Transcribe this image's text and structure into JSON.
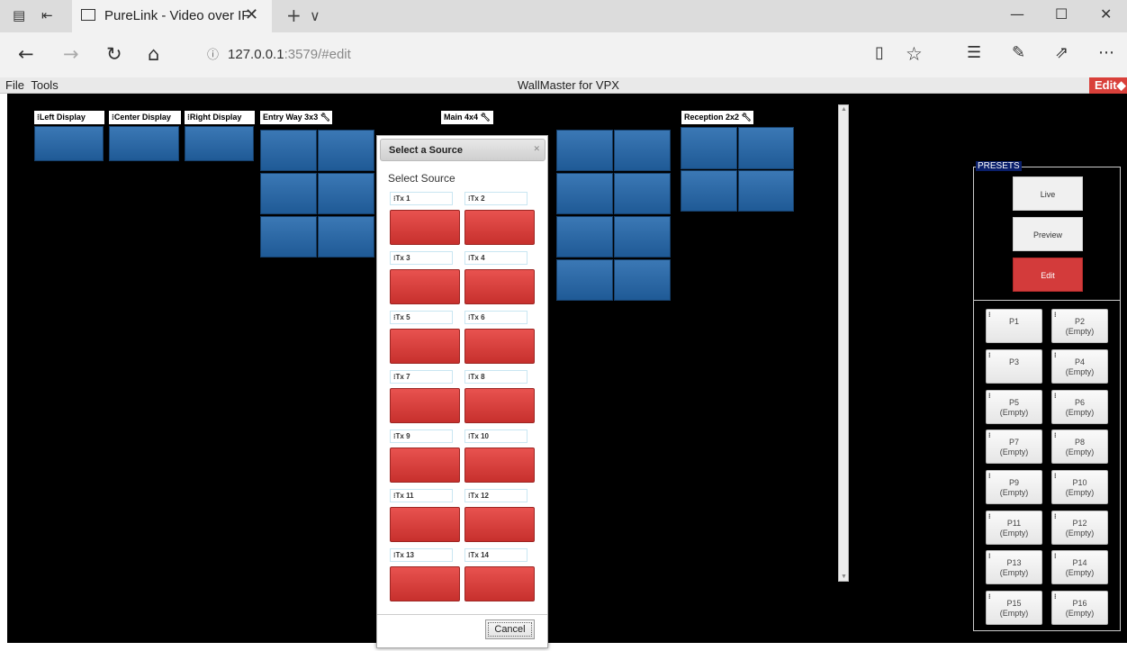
{
  "browser": {
    "tab_title": "PureLink - Video over IF",
    "tab_close": "✕",
    "new_tab": "+",
    "tab_dropdown": "∨",
    "url_host": "127.0.0.1",
    "url_rest": ":3579/#edit",
    "info_glyph": "ⓘ",
    "icons": [
      "tab-actions-icon",
      "back-icon",
      "forward-icon",
      "refresh-icon",
      "home-icon",
      "reading-view-icon",
      "favorite-star-icon",
      "favorites-hub-icon",
      "pen-icon",
      "share-icon",
      "more-icon",
      "minimize-icon",
      "maximize-icon",
      "close-window-icon"
    ]
  },
  "appbar": {
    "menu": [
      "File",
      "Tools"
    ],
    "title": "WallMaster for VPX",
    "edit_badge": "Edit"
  },
  "walls": {
    "left": "Left Display",
    "center": "Center Display",
    "right": "Right Display",
    "entry": "Entry Way 3x3",
    "main": "Main 4x4",
    "reception": "Reception 2x2"
  },
  "presets": {
    "title": "PRESETS",
    "live": "Live",
    "preview": "Preview",
    "edit": "Edit",
    "items": [
      {
        "name": "P1",
        "status": ""
      },
      {
        "name": "P2",
        "status": "(Empty)"
      },
      {
        "name": "P3",
        "status": ""
      },
      {
        "name": "P4",
        "status": "(Empty)"
      },
      {
        "name": "P5",
        "status": "(Empty)"
      },
      {
        "name": "P6",
        "status": "(Empty)"
      },
      {
        "name": "P7",
        "status": "(Empty)"
      },
      {
        "name": "P8",
        "status": "(Empty)"
      },
      {
        "name": "P9",
        "status": "(Empty)"
      },
      {
        "name": "P10",
        "status": "(Empty)"
      },
      {
        "name": "P11",
        "status": "(Empty)"
      },
      {
        "name": "P12",
        "status": "(Empty)"
      },
      {
        "name": "P13",
        "status": "(Empty)"
      },
      {
        "name": "P14",
        "status": "(Empty)"
      },
      {
        "name": "P15",
        "status": "(Empty)"
      },
      {
        "name": "P16",
        "status": "(Empty)"
      }
    ]
  },
  "dialog": {
    "title": "Select a Source",
    "close": "✕",
    "subtitle": "Select Source",
    "sources": [
      "Tx 1",
      "Tx 2",
      "Tx 3",
      "Tx 4",
      "Tx 5",
      "Tx 6",
      "Tx 7",
      "Tx 8",
      "Tx 9",
      "Tx 10",
      "Tx 11",
      "Tx 12",
      "Tx 13",
      "Tx 14"
    ],
    "cancel": "Cancel"
  },
  "colors": {
    "tile_blue": "#2c68a6",
    "source_red": "#d6403d",
    "accent_red": "#d33b3b",
    "canvas": "#000000"
  }
}
